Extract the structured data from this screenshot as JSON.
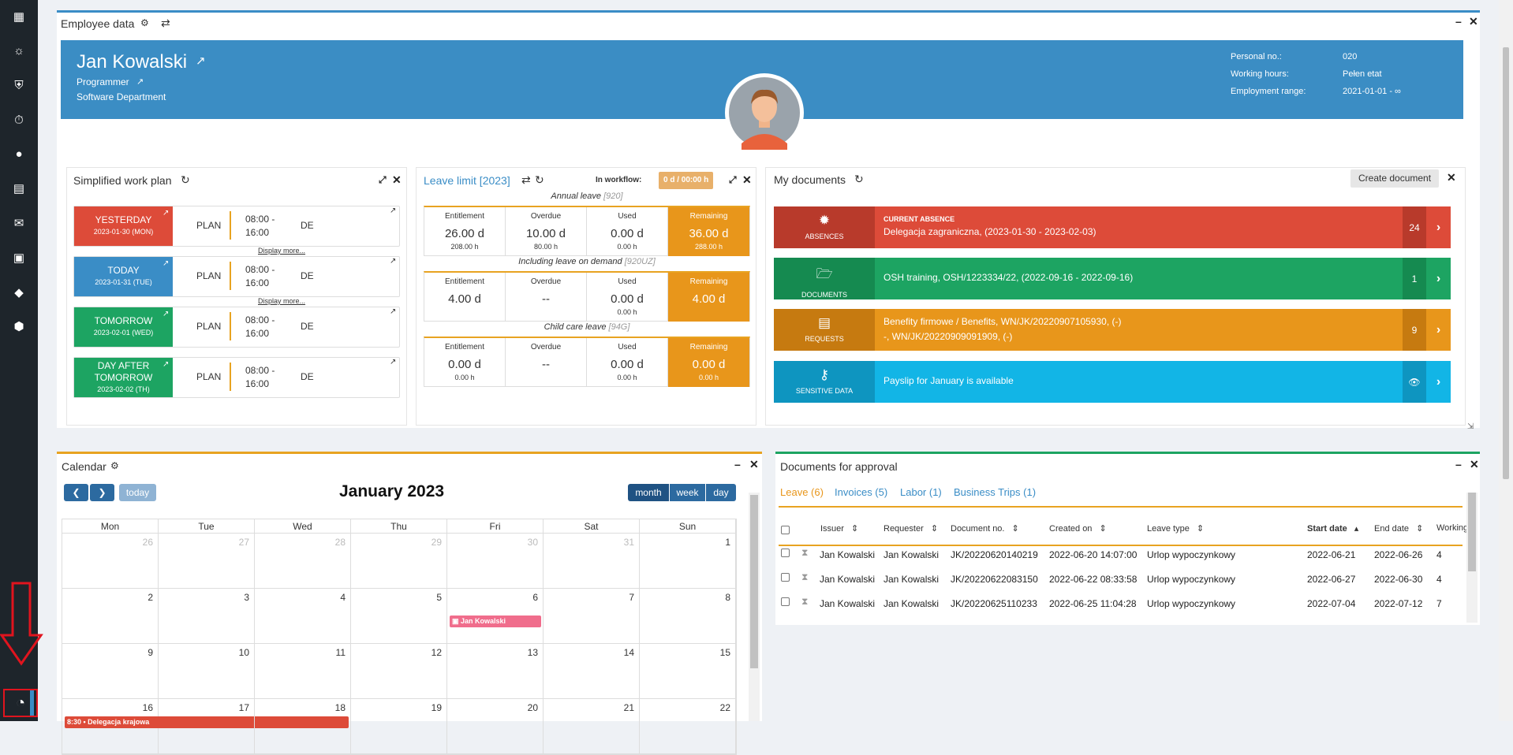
{
  "sidebar": {
    "icons": [
      "sitemap-icon",
      "sun-icon",
      "shield-check-icon",
      "stopwatch-icon",
      "globe-icon",
      "money-document-icon",
      "envelope-icon",
      "id-card-icon",
      "tag-icon",
      "cube-icon"
    ],
    "bottom_icon": "dashboard-gauge-icon"
  },
  "employee_panel": {
    "title": "Employee data",
    "name": "Jan Kowalski",
    "position": "Programmer",
    "department": "Software Department",
    "details": [
      {
        "label": "Personal no.:",
        "value": "020"
      },
      {
        "label": "Working hours:",
        "value": "Pełen etat"
      },
      {
        "label": "Employment range:",
        "value": "2021-01-01 - ∞"
      }
    ]
  },
  "work_plan": {
    "title": "Simplified work plan",
    "display_more": "Display more...",
    "rows": [
      {
        "label": "YESTERDAY",
        "date": "2023-01-30 (MON)",
        "color": "#dd4b39",
        "plan": "PLAN",
        "time1": "08:00 -",
        "time2": "16:00",
        "code": "DE"
      },
      {
        "label": "TODAY",
        "date": "2023-01-31 (TUE)",
        "color": "#3a8dc6",
        "plan": "PLAN",
        "time1": "08:00 -",
        "time2": "16:00",
        "code": "DE"
      },
      {
        "label": "TOMORROW",
        "date": "2023-02-01 (WED)",
        "color": "#1da462",
        "plan": "PLAN",
        "time1": "08:00 -",
        "time2": "16:00",
        "code": "DE"
      },
      {
        "label": "DAY AFTER TOMORROW",
        "date": "2023-02-02 (TH)",
        "color": "#1da462",
        "plan": "PLAN",
        "time1": "08:00 -",
        "time2": "16:00",
        "code": "DE"
      }
    ]
  },
  "leave_limit": {
    "title": "Leave limit [2023]",
    "in_workflow_label": "In workflow:",
    "in_workflow_value": "0 d / 00:00 h",
    "headers": [
      "Entitlement",
      "Overdue",
      "Used",
      "Remaining"
    ],
    "groups": [
      {
        "caption": "Annual leave",
        "code": "[920]",
        "cells": [
          {
            "v": "26.00 d",
            "s": "208.00 h"
          },
          {
            "v": "10.00 d",
            "s": "80.00 h"
          },
          {
            "v": "0.00 d",
            "s": "0.00 h"
          },
          {
            "v": "36.00 d",
            "s": "288.00 h"
          }
        ]
      },
      {
        "caption": "Including leave on demand",
        "code": "[920UZ]",
        "cells": [
          {
            "v": "4.00 d",
            "s": ""
          },
          {
            "v": "--",
            "s": ""
          },
          {
            "v": "0.00 d",
            "s": "0.00 h"
          },
          {
            "v": "4.00 d",
            "s": ""
          }
        ]
      },
      {
        "caption": "Child care leave",
        "code": "[94G]",
        "cells": [
          {
            "v": "0.00 d",
            "s": "0.00 h"
          },
          {
            "v": "--",
            "s": ""
          },
          {
            "v": "0.00 d",
            "s": "0.00 h"
          },
          {
            "v": "0.00 d",
            "s": "0.00 h"
          }
        ]
      }
    ]
  },
  "my_documents": {
    "title": "My documents",
    "create_label": "Create document",
    "rows": [
      {
        "label": "ABSENCES",
        "icon": "gear-icon",
        "color": "#dd4b39",
        "dark": "#b83a2b",
        "line1": "CURRENT ABSENCE",
        "line2": "Delegacja zagraniczna, (2023-01-30 - 2023-02-03)",
        "count": "24"
      },
      {
        "label": "DOCUMENTS",
        "icon": "folder-open-icon",
        "color": "#1da462",
        "dark": "#158a50",
        "line1": "OSH training, OSH/1223334/22, (2022-09-16 - 2022-09-16)",
        "line2": "",
        "count": "1"
      },
      {
        "label": "REQUESTS",
        "icon": "document-icon",
        "color": "#e8961b",
        "dark": "#c67a10",
        "line1": "Benefity firmowe / Benefits, WN/JK/20220907105930, (-)",
        "line2": "-, WN/JK/20220909091909, (-)",
        "count": "9"
      },
      {
        "label": "SENSITIVE DATA",
        "icon": "key-icon",
        "color": "#12b5e6",
        "dark": "#0e95c0",
        "line1": "Payslip for January is available",
        "line2": "",
        "count": "👁"
      }
    ]
  },
  "calendar": {
    "title": "Calendar",
    "today_label": "today",
    "month_title": "January 2023",
    "views": [
      "month",
      "week",
      "day"
    ],
    "weekdays": [
      "Mon",
      "Tue",
      "Wed",
      "Thu",
      "Fri",
      "Sat",
      "Sun"
    ],
    "weeks": [
      [
        "26",
        "27",
        "28",
        "29",
        "30",
        "31",
        "1"
      ],
      [
        "2",
        "3",
        "4",
        "5",
        "6",
        "7",
        "8"
      ],
      [
        "9",
        "10",
        "11",
        "12",
        "13",
        "14",
        "15"
      ],
      [
        "16",
        "17",
        "18",
        "19",
        "20",
        "21",
        "22"
      ]
    ],
    "event": "Jan Kowalski",
    "event2": "8:30 • Delegacja krajowa"
  },
  "approvals": {
    "title": "Documents for approval",
    "tabs": [
      "Leave (6)",
      "Invoices (5)",
      "Labor (1)",
      "Business Trips (1)"
    ],
    "columns": [
      "Issuer",
      "Requester",
      "Document no.",
      "Created on",
      "Leave type",
      "Start date",
      "End date",
      "Working"
    ],
    "rows": [
      [
        "Jan Kowalski",
        "Jan Kowalski",
        "JK/20220620140219",
        "2022-06-20 14:07:00",
        "Urlop wypoczynkowy",
        "2022-06-21",
        "2022-06-26",
        "4"
      ],
      [
        "Jan Kowalski",
        "Jan Kowalski",
        "JK/20220622083150",
        "2022-06-22 08:33:58",
        "Urlop wypoczynkowy",
        "2022-06-27",
        "2022-06-30",
        "4"
      ],
      [
        "Jan Kowalski",
        "Jan Kowalski",
        "JK/20220625110233",
        "2022-06-25 11:04:28",
        "Urlop wypoczynkowy",
        "2022-07-04",
        "2022-07-12",
        "7"
      ]
    ]
  }
}
